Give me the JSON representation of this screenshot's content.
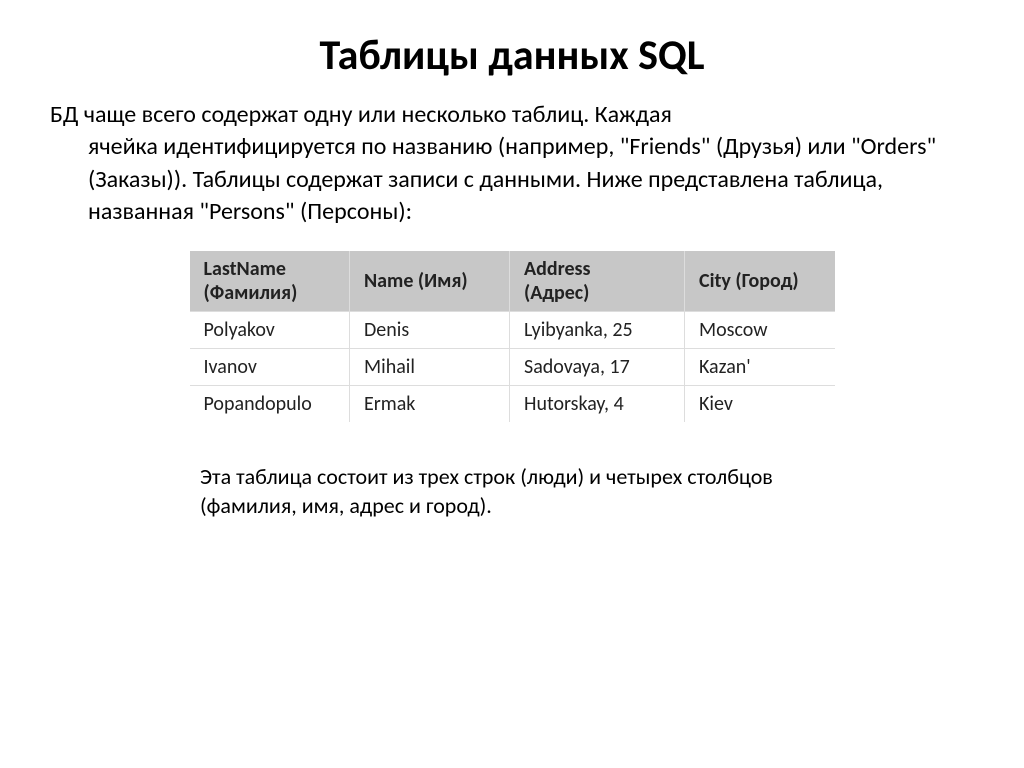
{
  "title": "Таблицы данных SQL",
  "intro": {
    "first": "БД чаще всего содержат одну или несколько таблиц. Каждая",
    "rest": "ячейка идентифицируется по названию (например, \"Friends\" (Друзья) или \"Orders\" (Заказы)). Таблицы содержат записи с данными. Ниже представлена таблица, названная \"Persons\" (Персоны):"
  },
  "table": {
    "headers": [
      {
        "line1": "LastName",
        "line2": "(Фамилия)"
      },
      {
        "line1": "Name (Имя)",
        "line2": ""
      },
      {
        "line1": "Address",
        "line2": "(Адрес)"
      },
      {
        "line1": "City (Город)",
        "line2": ""
      }
    ],
    "rows": [
      {
        "c0": "Polyakov",
        "c1": "Denis",
        "c2": "Lyibyanka, 25",
        "c3": "Moscow"
      },
      {
        "c0": "Ivanov",
        "c1": "Mihail",
        "c2": "Sadovaya, 17",
        "c3": "Kazan'"
      },
      {
        "c0": "Popandopulo",
        "c1": "Ermak",
        "c2": "Hutorskay, 4",
        "c3": "Kiev"
      }
    ]
  },
  "footer": "Эта таблица состоит из трех строк (люди) и четырех столбцов (фамилия, имя, адрес и город)."
}
